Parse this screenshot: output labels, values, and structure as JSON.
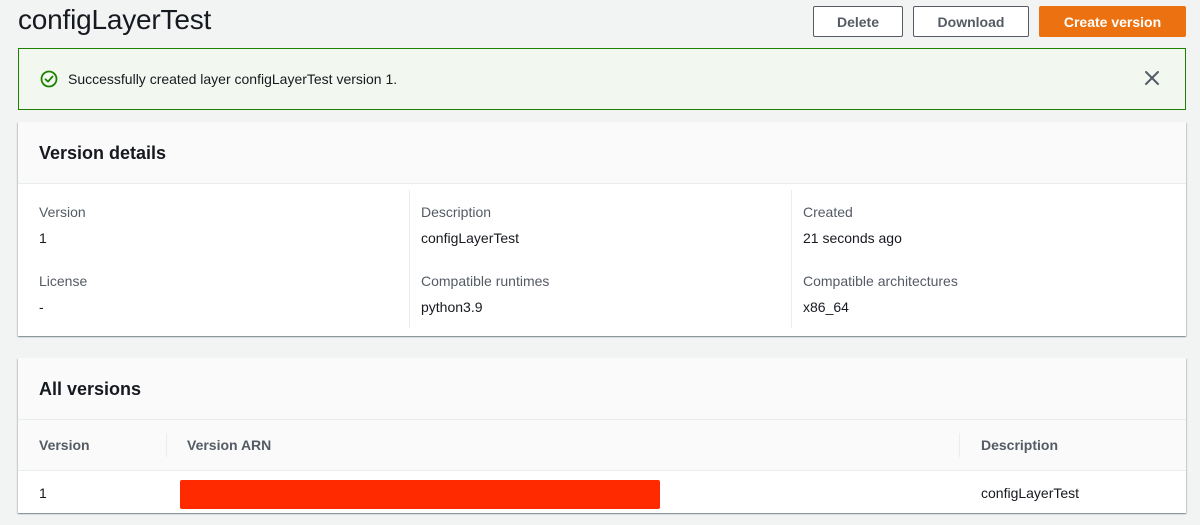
{
  "header": {
    "title": "configLayerTest",
    "delete_label": "Delete",
    "download_label": "Download",
    "create_label": "Create version"
  },
  "flash": {
    "message": "Successfully created layer configLayerTest version 1.",
    "icon": "success-check-icon",
    "close_icon": "close-icon",
    "color": "#1d8102"
  },
  "details": {
    "title": "Version details",
    "fields": [
      {
        "label": "Version",
        "value": "1"
      },
      {
        "label": "Description",
        "value": "configLayerTest"
      },
      {
        "label": "Created",
        "value": "21 seconds ago"
      },
      {
        "label": "License",
        "value": "-"
      },
      {
        "label": "Compatible runtimes",
        "value": "python3.9"
      },
      {
        "label": "Compatible architectures",
        "value": "x86_64"
      }
    ]
  },
  "versions": {
    "title": "All versions",
    "columns": [
      "Version",
      "Version ARN",
      "Description"
    ],
    "rows": [
      {
        "version": "1",
        "arn": "",
        "description": "configLayerTest"
      }
    ]
  },
  "colors": {
    "primary": "#ec7211",
    "success": "#1d8102",
    "redaction": "#ff2a00"
  }
}
